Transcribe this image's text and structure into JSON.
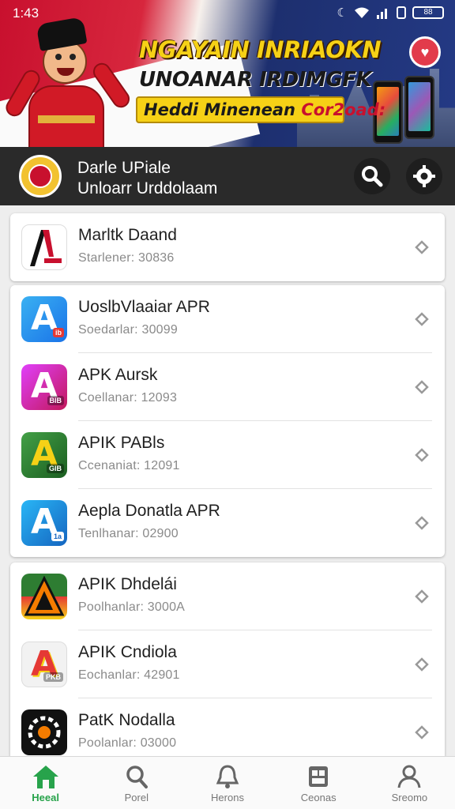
{
  "status_bar": {
    "time": "1:43",
    "battery": "88"
  },
  "banner": {
    "line1": "NGAYAIN INRIAOKN",
    "line2": "UNOANAR IRDIMGFK",
    "line3_a": "Heddi Minenean",
    "line3_b": "Cor2oad:"
  },
  "app_header": {
    "title_line1": "Darle UPiale",
    "title_line2": "Unloarr Urddolaam"
  },
  "apps": [
    {
      "name": "Marltk Daand",
      "subtitle": "Starlener: 30836",
      "icon": "black-red-a-icon",
      "tag": ""
    },
    {
      "name": "UoslbVlaaiar APR",
      "subtitle": "Soedarlar: 30099",
      "icon": "blue-a-icon",
      "tag": ""
    },
    {
      "name": "APK Aursk",
      "subtitle": "Coellanar: 12093",
      "icon": "pink-a-icon",
      "tag": ""
    },
    {
      "name": "APIK PABls",
      "subtitle": "Ccenaniat: 12091",
      "icon": "green-a-icon",
      "tag": ""
    },
    {
      "name": "Aepla Donatla APR",
      "subtitle": "Tenlhanar: 02900",
      "icon": "blue-a-icon",
      "tag": ""
    },
    {
      "name": "APIK Dhdelái",
      "subtitle": "Poolhanlar: 3000A",
      "icon": "indonesia-a-icon",
      "tag": ""
    },
    {
      "name": "APIK Cndiola",
      "subtitle": "Eochanlar: 42901",
      "icon": "red-yellow-a-icon",
      "tag": "PKB"
    },
    {
      "name": "PatK Nodalla",
      "subtitle": "Poolanlar: 03000",
      "icon": "gear-app-icon",
      "tag": ""
    }
  ],
  "bottom_nav": [
    {
      "label": "Heeal",
      "icon": "home-icon",
      "active": true
    },
    {
      "label": "Porel",
      "icon": "search-icon",
      "active": false
    },
    {
      "label": "Herons",
      "icon": "bell-icon",
      "active": false
    },
    {
      "label": "Ceonas",
      "icon": "category-icon",
      "active": false
    },
    {
      "label": "Sreomo",
      "icon": "profile-icon",
      "active": false
    }
  ],
  "colors": {
    "accent": "#27a34b",
    "header": "#2a2a2a",
    "banner_red": "#c8102e",
    "banner_yellow": "#f6d116"
  }
}
